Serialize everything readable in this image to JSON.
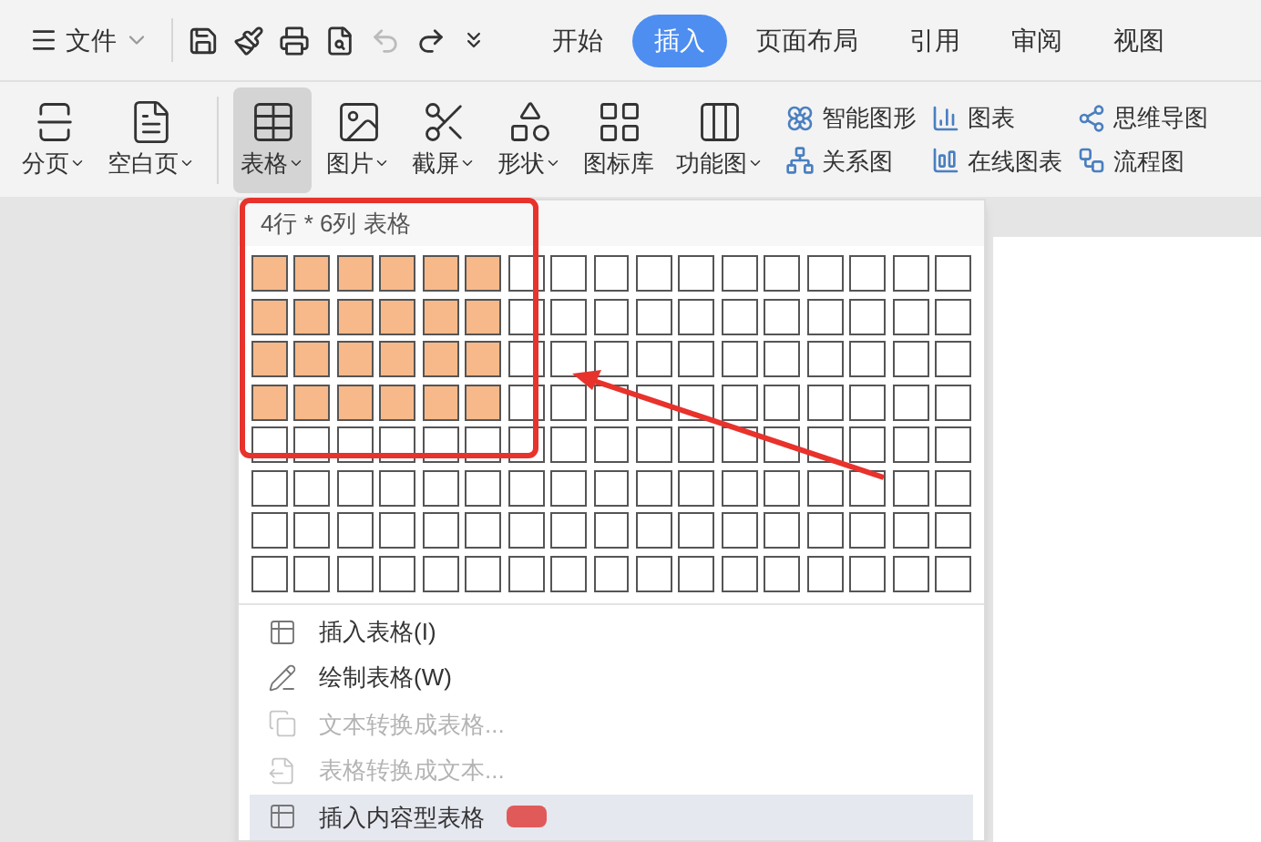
{
  "quick_toolbar": {
    "file_menu": "文件"
  },
  "tabs": [
    {
      "label": "开始",
      "selected": false
    },
    {
      "label": "插入",
      "selected": true
    },
    {
      "label": "页面布局",
      "selected": false
    },
    {
      "label": "引用",
      "selected": false
    },
    {
      "label": "审阅",
      "selected": false
    },
    {
      "label": "视图",
      "selected": false
    }
  ],
  "ribbon": {
    "large_buttons": [
      {
        "kind": "pagebreak",
        "label": "分页",
        "dropdown": true,
        "pressed": false
      },
      {
        "kind": "blank",
        "label": "空白页",
        "dropdown": true,
        "pressed": false
      },
      {
        "kind": "table",
        "label": "表格",
        "dropdown": true,
        "pressed": true
      },
      {
        "kind": "picture",
        "label": "图片",
        "dropdown": true,
        "pressed": false
      },
      {
        "kind": "screenshot",
        "label": "截屏",
        "dropdown": true,
        "pressed": false
      },
      {
        "kind": "shape",
        "label": "形状",
        "dropdown": true,
        "pressed": false
      },
      {
        "kind": "iconlib",
        "label": "图标库",
        "dropdown": false,
        "pressed": false
      },
      {
        "kind": "function",
        "label": "功能图",
        "dropdown": true,
        "pressed": false
      }
    ],
    "small_buttons": [
      {
        "kind": "smartart",
        "label": "智能图形"
      },
      {
        "kind": "relation",
        "label": "关系图"
      },
      {
        "kind": "chart",
        "label": "图表"
      },
      {
        "kind": "onlinechart",
        "label": "在线图表"
      },
      {
        "kind": "mindmap",
        "label": "思维导图"
      },
      {
        "kind": "flowchart",
        "label": "流程图"
      }
    ]
  },
  "table_menu": {
    "header": "4行 * 6列 表格",
    "grid": [
      [
        {
          "selected": true
        },
        {
          "selected": true
        },
        {
          "selected": true
        },
        {
          "selected": true
        },
        {
          "selected": true
        },
        {
          "selected": true
        },
        {
          "selected": false
        },
        {
          "selected": false
        },
        {
          "selected": false
        },
        {
          "selected": false
        },
        {
          "selected": false
        },
        {
          "selected": false
        },
        {
          "selected": false
        },
        {
          "selected": false
        },
        {
          "selected": false
        },
        {
          "selected": false
        },
        {
          "selected": false
        }
      ],
      [
        {
          "selected": true
        },
        {
          "selected": true
        },
        {
          "selected": true
        },
        {
          "selected": true
        },
        {
          "selected": true
        },
        {
          "selected": true
        },
        {
          "selected": false
        },
        {
          "selected": false
        },
        {
          "selected": false
        },
        {
          "selected": false
        },
        {
          "selected": false
        },
        {
          "selected": false
        },
        {
          "selected": false
        },
        {
          "selected": false
        },
        {
          "selected": false
        },
        {
          "selected": false
        },
        {
          "selected": false
        }
      ],
      [
        {
          "selected": true
        },
        {
          "selected": true
        },
        {
          "selected": true
        },
        {
          "selected": true
        },
        {
          "selected": true
        },
        {
          "selected": true
        },
        {
          "selected": false
        },
        {
          "selected": false
        },
        {
          "selected": false
        },
        {
          "selected": false
        },
        {
          "selected": false
        },
        {
          "selected": false
        },
        {
          "selected": false
        },
        {
          "selected": false
        },
        {
          "selected": false
        },
        {
          "selected": false
        },
        {
          "selected": false
        }
      ],
      [
        {
          "selected": true
        },
        {
          "selected": true
        },
        {
          "selected": true
        },
        {
          "selected": true
        },
        {
          "selected": true
        },
        {
          "selected": true
        },
        {
          "selected": false
        },
        {
          "selected": false
        },
        {
          "selected": false
        },
        {
          "selected": false
        },
        {
          "selected": false
        },
        {
          "selected": false
        },
        {
          "selected": false
        },
        {
          "selected": false
        },
        {
          "selected": false
        },
        {
          "selected": false
        },
        {
          "selected": false
        }
      ],
      [
        {
          "selected": false
        },
        {
          "selected": false
        },
        {
          "selected": false
        },
        {
          "selected": false
        },
        {
          "selected": false
        },
        {
          "selected": false
        },
        {
          "selected": false
        },
        {
          "selected": false
        },
        {
          "selected": false
        },
        {
          "selected": false
        },
        {
          "selected": false
        },
        {
          "selected": false
        },
        {
          "selected": false
        },
        {
          "selected": false
        },
        {
          "selected": false
        },
        {
          "selected": false
        },
        {
          "selected": false
        }
      ],
      [
        {
          "selected": false
        },
        {
          "selected": false
        },
        {
          "selected": false
        },
        {
          "selected": false
        },
        {
          "selected": false
        },
        {
          "selected": false
        },
        {
          "selected": false
        },
        {
          "selected": false
        },
        {
          "selected": false
        },
        {
          "selected": false
        },
        {
          "selected": false
        },
        {
          "selected": false
        },
        {
          "selected": false
        },
        {
          "selected": false
        },
        {
          "selected": false
        },
        {
          "selected": false
        },
        {
          "selected": false
        }
      ],
      [
        {
          "selected": false
        },
        {
          "selected": false
        },
        {
          "selected": false
        },
        {
          "selected": false
        },
        {
          "selected": false
        },
        {
          "selected": false
        },
        {
          "selected": false
        },
        {
          "selected": false
        },
        {
          "selected": false
        },
        {
          "selected": false
        },
        {
          "selected": false
        },
        {
          "selected": false
        },
        {
          "selected": false
        },
        {
          "selected": false
        },
        {
          "selected": false
        },
        {
          "selected": false
        },
        {
          "selected": false
        }
      ],
      [
        {
          "selected": false
        },
        {
          "selected": false
        },
        {
          "selected": false
        },
        {
          "selected": false
        },
        {
          "selected": false
        },
        {
          "selected": false
        },
        {
          "selected": false
        },
        {
          "selected": false
        },
        {
          "selected": false
        },
        {
          "selected": false
        },
        {
          "selected": false
        },
        {
          "selected": false
        },
        {
          "selected": false
        },
        {
          "selected": false
        },
        {
          "selected": false
        },
        {
          "selected": false
        },
        {
          "selected": false
        }
      ]
    ],
    "items": [
      {
        "kind": "insert",
        "label": "插入表格(I)",
        "disabled": false,
        "highlighted": false
      },
      {
        "kind": "draw",
        "label": "绘制表格(W)",
        "disabled": false,
        "highlighted": false
      },
      {
        "kind": "text2table",
        "label": "文本转换成表格...",
        "disabled": true,
        "highlighted": false
      },
      {
        "kind": "table2text",
        "label": "表格转换成文本...",
        "disabled": true,
        "highlighted": false
      },
      {
        "kind": "content",
        "label": "插入内容型表格",
        "disabled": false,
        "highlighted": true,
        "badge": true
      }
    ]
  }
}
